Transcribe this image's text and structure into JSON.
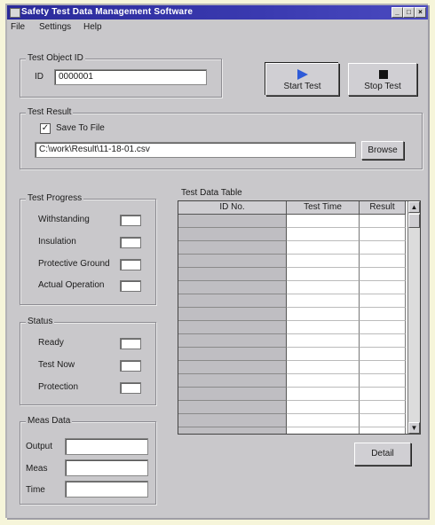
{
  "window": {
    "title": "Safety Test Data Management Software",
    "controls": [
      "_",
      "□",
      "×"
    ]
  },
  "menu": [
    "File",
    "Settings",
    "Help"
  ],
  "test_object": {
    "group_label": "Test Object ID",
    "id_label": "ID",
    "id_value": "0000001"
  },
  "buttons": {
    "start": "Start Test",
    "stop": "Stop Test",
    "browse": "Browse",
    "detail": "Detail"
  },
  "test_result": {
    "group_label": "Test Result",
    "save_to_file_label": "Save To File",
    "save_to_file_checked": true,
    "file_path": "C:\\work\\Result\\11-18-01.csv"
  },
  "test_progress": {
    "group_label": "Test Progress",
    "items": [
      "Withstanding",
      "Insulation",
      "Protective Ground",
      "Actual Operation"
    ]
  },
  "status": {
    "group_label": "Status",
    "items": [
      "Ready",
      "Test Now",
      "Protection"
    ]
  },
  "meas_data": {
    "group_label": "Meas Data",
    "fields": [
      "Output",
      "Meas",
      "Time"
    ]
  },
  "table": {
    "title": "Test Data Table",
    "columns": [
      "ID No.",
      "Test Time",
      "Result"
    ],
    "row_count": 17
  },
  "colors": {
    "title_bar": "#2a2a9a",
    "window_face": "#c9c8cb",
    "background": "#f6f5da",
    "start_icon": "#2e5bd8",
    "stop_icon": "#111111"
  }
}
